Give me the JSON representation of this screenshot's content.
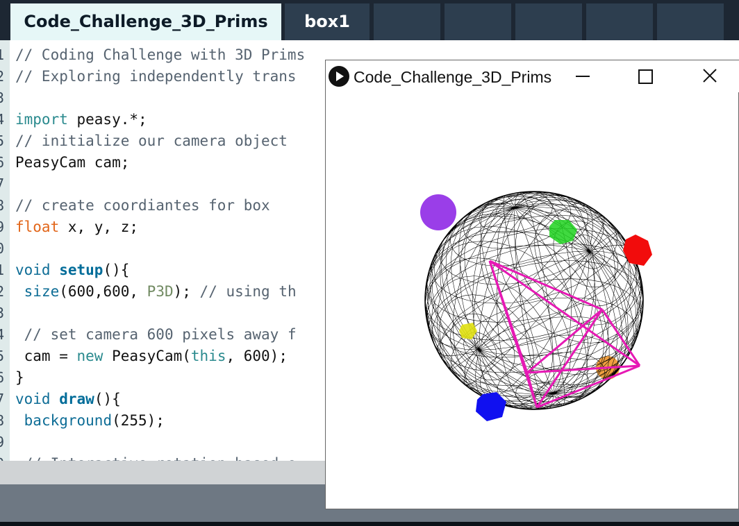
{
  "editor": {
    "tabs": [
      {
        "label": "Code_Challenge_3D_Prims",
        "active": true
      },
      {
        "label": "box1",
        "active": false
      },
      {
        "label": "",
        "active": false
      },
      {
        "label": "",
        "active": false
      },
      {
        "label": "",
        "active": false
      },
      {
        "label": "",
        "active": false
      },
      {
        "label": "",
        "active": false
      }
    ],
    "line_numbers": [
      "1",
      "2",
      "3",
      "4",
      "5",
      "6",
      "7",
      "8",
      "9",
      "0",
      "1",
      "2",
      "3",
      "4",
      "5",
      "6",
      "7",
      "8",
      "9",
      "0"
    ],
    "code_lines": [
      "// Coding Challenge with 3D Prims",
      "// Exploring independently trans",
      "",
      "import peasy.*;",
      "// initialize our camera object",
      "PeasyCam cam;",
      "",
      "// create coordiantes for box",
      "float x, y, z;",
      "",
      "void setup(){",
      " size(600,600, P3D); // using th",
      "",
      " // set camera 600 pixels away f",
      " cam = new PeasyCam(this, 600);",
      "}",
      "void draw(){",
      " background(255);",
      "",
      " // Interactive rotation based o"
    ]
  },
  "sketch_window": {
    "title": "Code_Challenge_3D_Prims",
    "minimize_icon": "minimize-icon",
    "maximize_icon": "maximize-icon",
    "close_icon": "close-icon",
    "sketch_colors": {
      "sphere_wire": "#000000",
      "pyramid": "#e619b4",
      "purple_sphere": "#9a3ee8",
      "green_shape": "#1fd21f",
      "red_shape": "#f20c0c",
      "yellow_shape": "#e0e010",
      "orange_shape": "#f0a040",
      "blue_shape": "#1010f0"
    }
  }
}
